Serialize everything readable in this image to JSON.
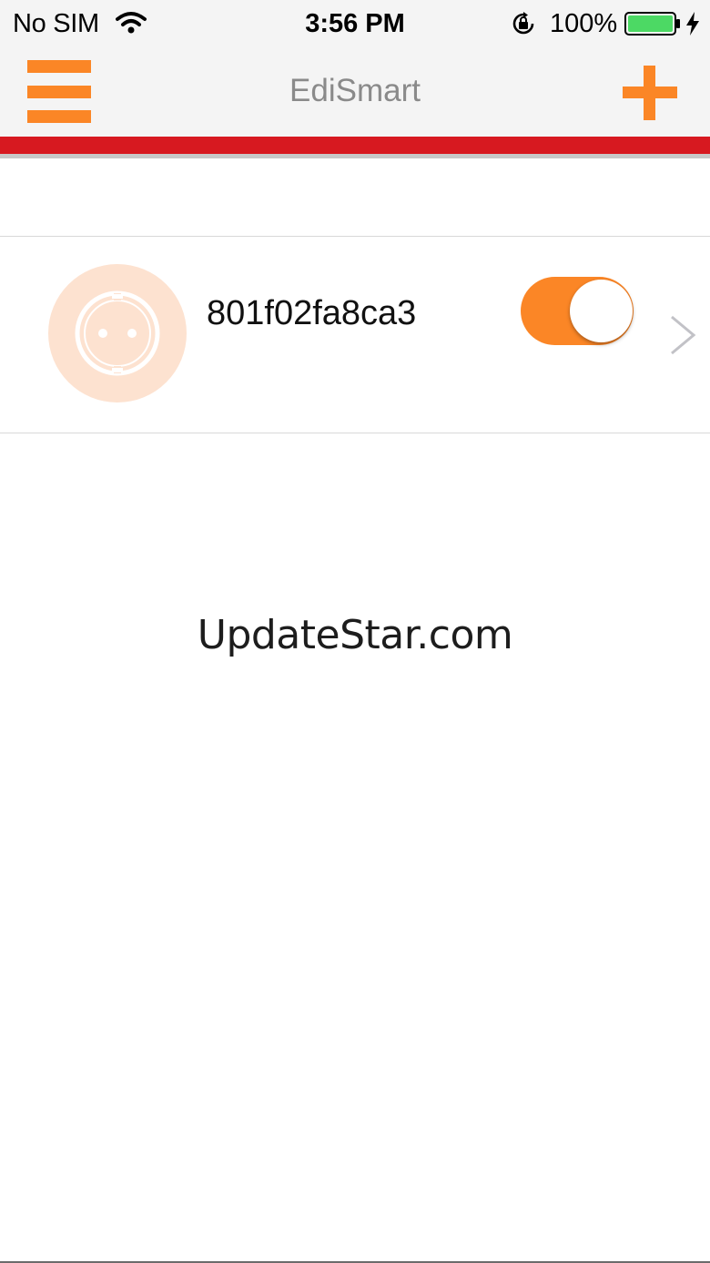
{
  "status_bar": {
    "carrier": "No SIM",
    "time": "3:56 PM",
    "battery_percent": "100%",
    "battery_level": 1.0,
    "icons": [
      "wifi-icon",
      "orientation-lock-icon",
      "battery-icon",
      "charging-bolt-icon"
    ]
  },
  "nav": {
    "title": "EdiSmart",
    "left_icon": "menu-icon",
    "right_icon": "add-icon"
  },
  "devices": [
    {
      "name": "801f02fa8ca3",
      "icon": "power-socket-icon",
      "toggle_on": true
    }
  ],
  "watermark": "UpdateStar.com",
  "colors": {
    "accent": "#fb8626",
    "brand_stripe": "#d71920",
    "bar_bg": "#f4f4f4",
    "title_gray": "#8a8a8a",
    "avatar_ring": "#fde2d0",
    "battery_green": "#4cd964"
  }
}
